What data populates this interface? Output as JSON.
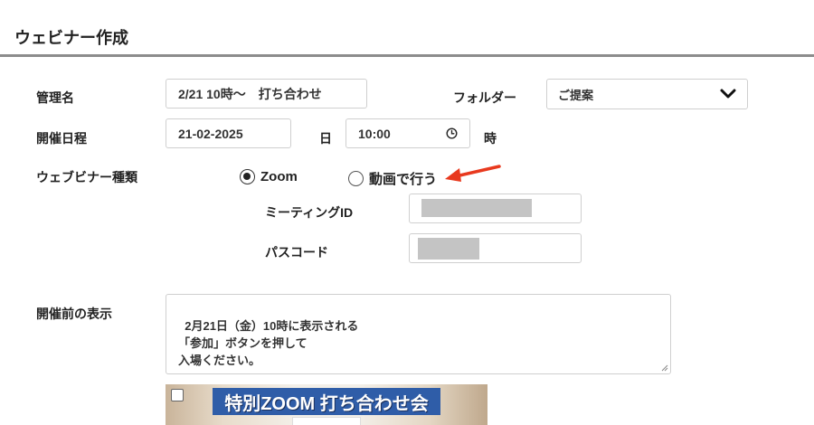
{
  "page": {
    "title": "ウェビナー作成"
  },
  "form": {
    "manage_name": {
      "label": "管理名",
      "value": "2/21 10時〜　打ち合わせ"
    },
    "folder": {
      "label": "フォルダー",
      "value": "ご提案"
    },
    "schedule": {
      "label": "開催日程",
      "date": "21-02-2025",
      "day_suffix": "日",
      "time": "10:00",
      "hour_suffix": "時"
    },
    "webinar_type": {
      "label": "ウェブビナー種類",
      "options": [
        {
          "label": "Zoom",
          "checked": true
        },
        {
          "label": "動画で行う",
          "checked": false
        }
      ]
    },
    "meeting_id": {
      "label": "ミーティングID"
    },
    "passcode": {
      "label": "パスコード"
    },
    "pre_display": {
      "label": "開催前の表示",
      "text": "2月21日（金）10時に表示される\n「参加」ボタンを押して\n入場ください。"
    },
    "image": {
      "banner_text": "特別ZOOM 打ち合わせ会"
    }
  },
  "colors": {
    "arrow": "#e8391e",
    "rule": "#8c8c8c",
    "redacted": "#c4c4c4"
  }
}
